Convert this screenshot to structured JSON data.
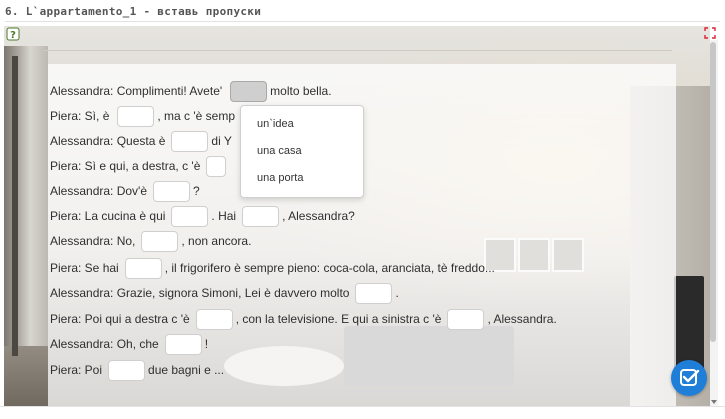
{
  "title": "6. L`appartamento_1 - вставь пропуски",
  "lines": [
    {
      "parts": [
        "Alessandra: Complimenti! Avete'",
        "molto bella."
      ]
    },
    {
      "parts": [
        "Piera: Sì, è",
        ", ma c 'è semp"
      ]
    },
    {
      "parts": [
        "Alessandra: Questa è",
        "di Y"
      ]
    },
    {
      "parts": [
        "Piera: Sì e qui, a destra, c 'è",
        ""
      ]
    },
    {
      "parts": [
        "Alessandra: Dov'è",
        "?"
      ]
    },
    {
      "parts": [
        "Piera: La cucina è qui",
        ". Hai",
        ", Alessandra?"
      ]
    },
    {
      "parts": [
        "Alessandra: No,",
        ", non ancora."
      ]
    },
    {
      "parts": [
        "Piera: Se hai",
        ", il frigorifero è sempre pieno: coca-cola, aranciata, tè freddo..."
      ]
    },
    {
      "parts": [
        "Alessandra: Grazie, signora Simoni, Lei è davvero molto",
        "."
      ]
    },
    {
      "parts": [
        "Piera: Poi qui a destra c 'è",
        ", con la televisione. E qui a sinistra c 'è",
        ", Alessandra."
      ]
    },
    {
      "parts": [
        "Alessandra: Oh, che",
        "!"
      ]
    },
    {
      "parts": [
        "Piera: Poi",
        "due bagni e ..."
      ]
    }
  ],
  "dropdown": {
    "options": [
      "un`idea",
      "una casa",
      "una porta"
    ]
  },
  "colors": {
    "accent": "#1f7fd8",
    "gap_active": "#cfcfcf"
  }
}
